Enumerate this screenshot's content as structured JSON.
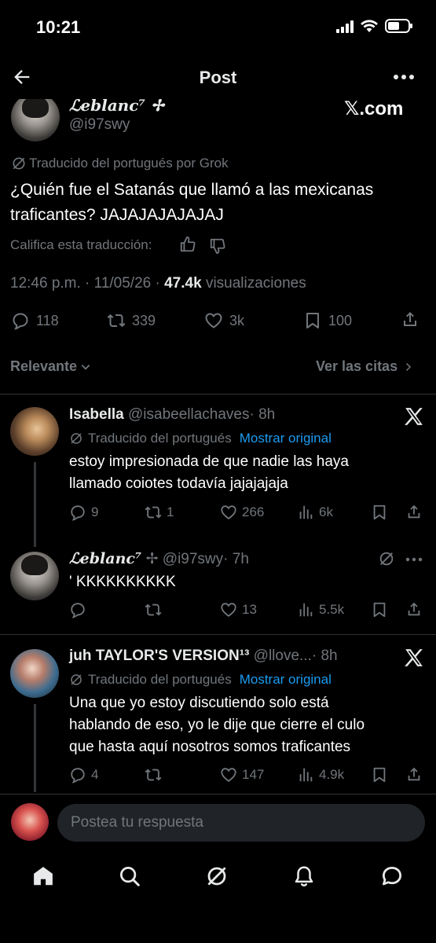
{
  "status_bar": {
    "time": "10:21"
  },
  "header": {
    "title": "Post"
  },
  "post": {
    "author_name": "ℒeblanc⁷ ✢",
    "author_handle": "@i97swy",
    "watermark": "𝕏.com",
    "translated_note": "Traducido del portugués por Grok",
    "text_line1": "¿Quién fue el Satanás que llamó a las mexicanas",
    "text_line2": "traficantes? JAJAJAJAJAJAJ",
    "rate_label": "Califica esta traducción:",
    "timestamp": "12:46 p.m. · 11/05/26 ·",
    "views_count": "47.4k",
    "views_label": "visualizaciones",
    "stats": {
      "replies": "118",
      "reposts": "339",
      "likes": "3k",
      "bookmarks": "100"
    }
  },
  "filters": {
    "sort_label": "Relevante",
    "quotes_label": "Ver las citas"
  },
  "replies": [
    {
      "name": "Isabella",
      "handle": "@isabeellachaves",
      "time": "· 8h",
      "translated": "Traducido del portugués",
      "show_original": "Mostrar original",
      "line1": "estoy impresionada de que nadie las haya",
      "line2": "llamado coiotes todavía jajajajaja",
      "replies": "9",
      "reposts": "1",
      "likes": "266",
      "views": "6k"
    },
    {
      "name": "ℒeblanc⁷",
      "handle": "✢ @i97swy",
      "time": "· 7h",
      "line1": "' KKKKKKKKKK",
      "replies": "",
      "reposts": "",
      "likes": "13",
      "views": "5.5k"
    },
    {
      "name": "juh TAYLOR'S VERSION¹³",
      "handle": "@llove...",
      "time": "· 8h",
      "translated": "Traducido del portugués",
      "show_original": "Mostrar original",
      "line1": "Una que yo estoy discutiendo solo está",
      "line2": "hablando de eso, yo le dije que cierre el culo",
      "line3": "que hasta aquí nosotros somos traficantes",
      "replies": "4",
      "reposts": "",
      "likes": "147",
      "views": "4.9k"
    }
  ],
  "composer": {
    "placeholder": "Postea tu respuesta"
  },
  "colors": {
    "background": "#000000",
    "accent": "#1d9bf0",
    "muted": "#71767b",
    "text": "#e7e9ea",
    "divider": "#2f3336"
  },
  "icons": [
    "back-arrow-icon",
    "more-icon",
    "x-logo-icon",
    "thumb-up-icon",
    "thumb-down-icon",
    "reply-icon",
    "repost-icon",
    "like-icon",
    "bookmark-icon",
    "share-icon",
    "views-icon",
    "grok-icon",
    "home-icon",
    "search-icon",
    "notifications-icon",
    "messages-icon"
  ]
}
